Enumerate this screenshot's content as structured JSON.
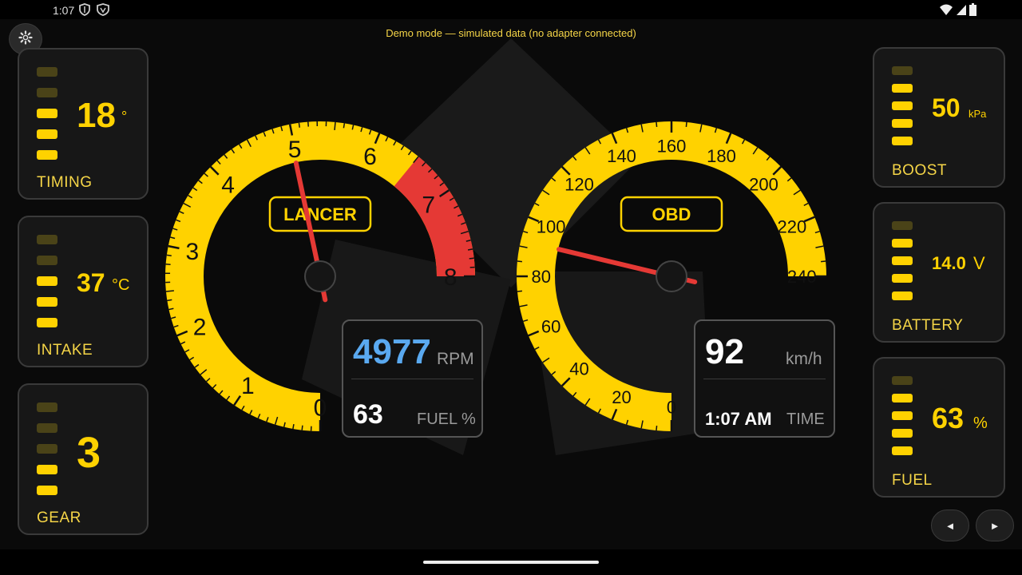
{
  "status_bar": {
    "time": "1:07"
  },
  "banner": "Demo mode — simulated data (no adapter connected)",
  "left_panels": [
    {
      "name": "timing",
      "value": "18",
      "unit": "°",
      "label": "TIMING",
      "bars_lit": 3
    },
    {
      "name": "intake",
      "value": "37",
      "unit": "°C",
      "label": "INTAKE",
      "bars_lit": 3
    },
    {
      "name": "gear",
      "value": "3",
      "unit": "",
      "label": "GEAR",
      "bars_lit": 2
    }
  ],
  "right_panels": [
    {
      "name": "boost",
      "value": "50",
      "unit": "kPa",
      "label": "BOOST",
      "bars_lit": 4
    },
    {
      "name": "battery",
      "value": "14.0",
      "unit": "V",
      "label": "BATTERY",
      "bars_lit": 4
    },
    {
      "name": "fuel",
      "value": "63",
      "unit": "%",
      "label": "FUEL",
      "bars_lit": 4
    }
  ],
  "gauges": {
    "rpm": {
      "badge": "LANCER",
      "ticks": [
        "0",
        "1",
        "2",
        "3",
        "4",
        "5",
        "6",
        "7",
        "8"
      ],
      "max": 8,
      "redline_from": 6.5,
      "needle_value": 4.977
    },
    "speed": {
      "badge": "OBD",
      "ticks": [
        "0",
        "20",
        "40",
        "60",
        "80",
        "100",
        "120",
        "140",
        "160",
        "180",
        "200",
        "220",
        "240"
      ],
      "max": 240,
      "needle_value": 92
    }
  },
  "rpm_box": {
    "rpm_value": "4977",
    "rpm_unit": "RPM",
    "fuel_value": "63",
    "fuel_label": "FUEL %"
  },
  "speed_box": {
    "speed_value": "92",
    "speed_unit": "km/h",
    "time_value": "1:07 AM",
    "time_label": "TIME"
  },
  "nav": {
    "prev": "◄",
    "next": "►"
  },
  "colors": {
    "accent": "#ffd200",
    "redline": "#e53935",
    "needle": "#e53935",
    "rpm_text": "#5aa9f0"
  }
}
